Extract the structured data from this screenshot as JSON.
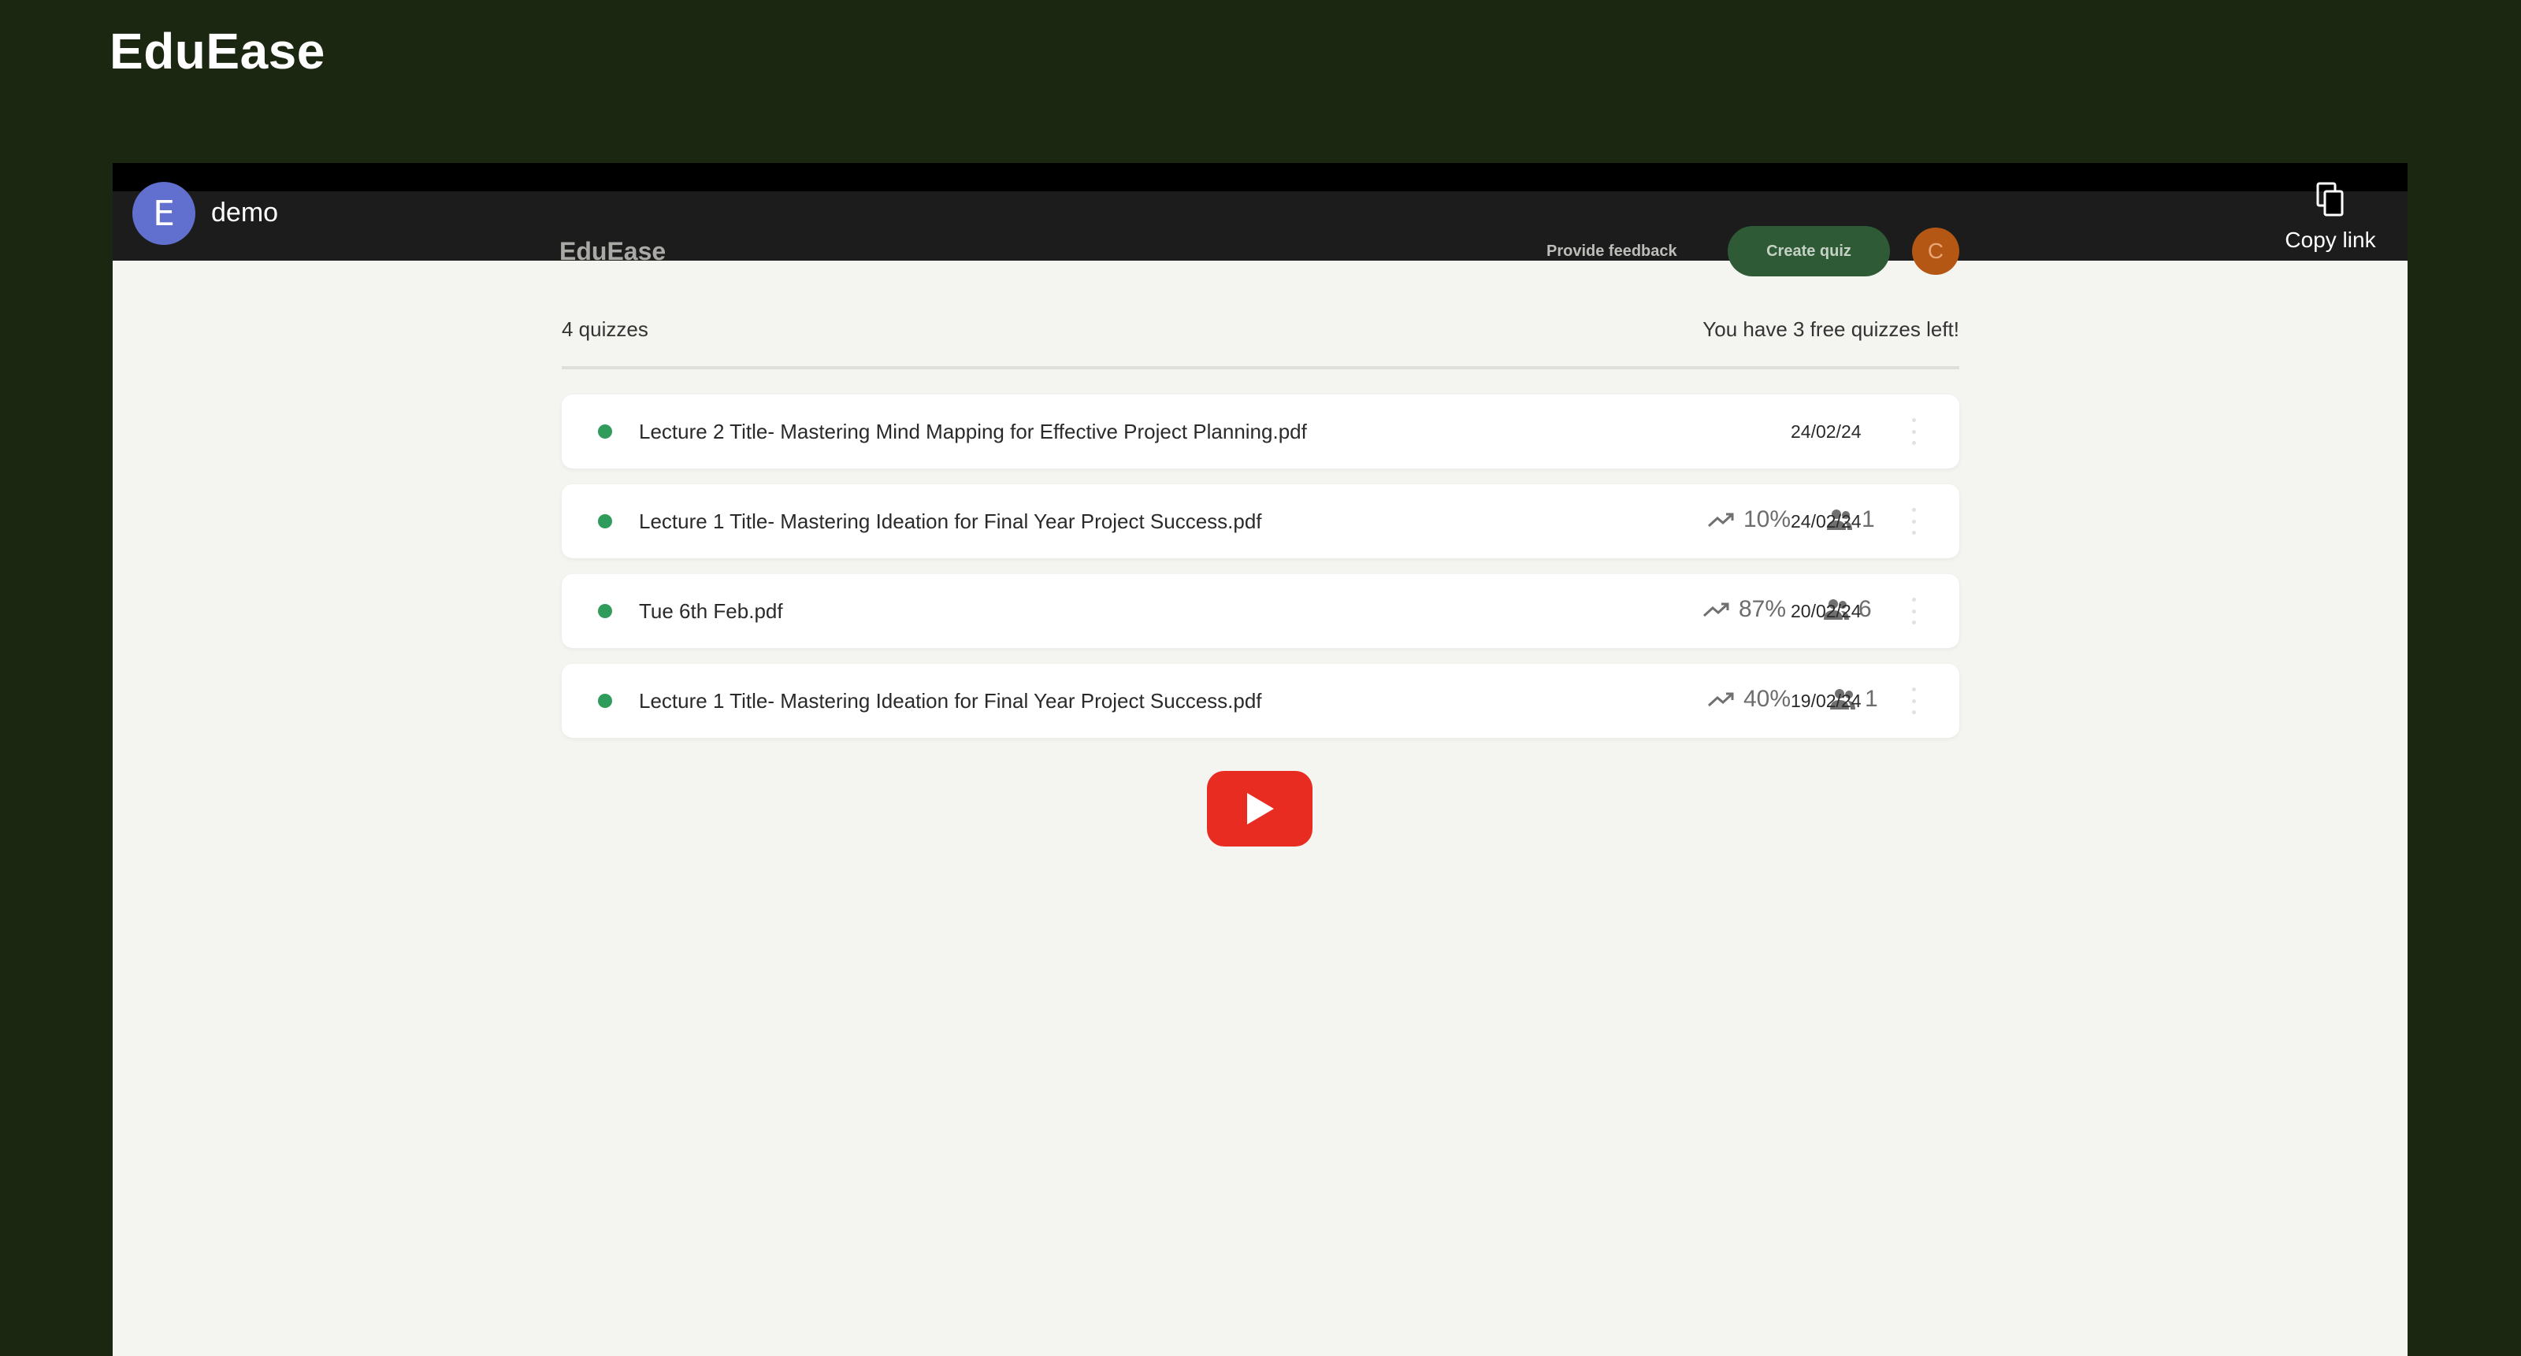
{
  "site": {
    "title": "EduEase"
  },
  "video": {
    "channel_initial": "E",
    "channel_name": "demo",
    "copy_link_label": "Copy link"
  },
  "app": {
    "brand": "EduEase",
    "feedback_label": "Provide feedback",
    "create_quiz_label": "Create quiz",
    "user_initial": "C"
  },
  "summary": {
    "count": "4 quizzes",
    "free_left": "You have 3 free quizzes left!"
  },
  "quizzes": [
    {
      "name": "Lecture 2 Title- Mastering Mind Mapping for Effective Project Planning.pdf",
      "score": "",
      "participants": "",
      "date": "24/02/24"
    },
    {
      "name": "Lecture 1 Title- Mastering Ideation for Final Year Project Success.pdf",
      "score": "10%",
      "participants": "1",
      "date": "24/02/24"
    },
    {
      "name": "Tue 6th Feb.pdf",
      "score": "87%",
      "participants": "6",
      "date": "20/02/24"
    },
    {
      "name": "Lecture 1 Title- Mastering Ideation for Final Year Project Success.pdf",
      "score": "40%",
      "participants": "1",
      "date": "19/02/24"
    }
  ],
  "colors": {
    "page_bg": "#1b2711",
    "status_dot": "#2f9c5c",
    "create_btn": "#2f5a36",
    "play_button": "#e92c21",
    "channel_avatar": "#6170cf",
    "user_avatar": "#b45614"
  },
  "icons": {
    "copy": "copy-icon",
    "trend": "trending-up-icon",
    "users": "users-icon",
    "menu": "more-vertical-icon",
    "play": "play-icon"
  }
}
